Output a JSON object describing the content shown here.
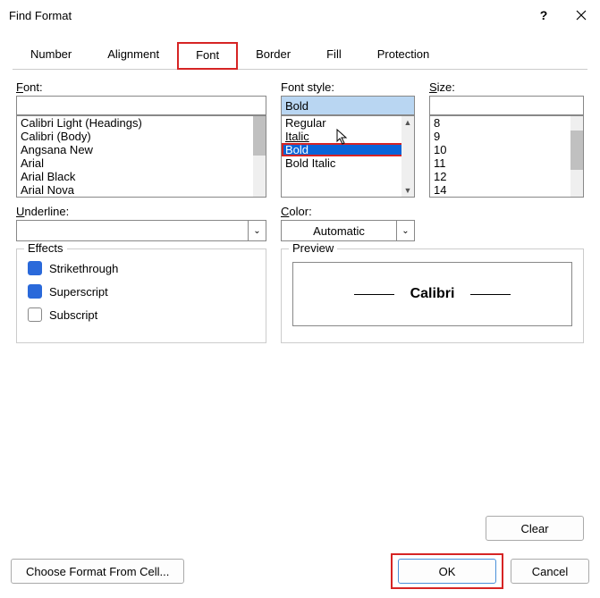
{
  "title": "Find Format",
  "tabs": {
    "number": "Number",
    "alignment": "Alignment",
    "font": "Font",
    "border": "Border",
    "fill": "Fill",
    "protection": "Protection"
  },
  "labels": {
    "font": "Font:",
    "fontstyle": "Font style:",
    "size": "Size:",
    "underline": "Underline:",
    "color": "Color:",
    "effects": "Effects",
    "preview": "Preview",
    "strike": "Strikethrough",
    "super": "Superscript",
    "sub": "Subscript"
  },
  "inputs": {
    "font_value": "",
    "style_value": "Bold",
    "size_value": "",
    "underline_value": "",
    "color_value": "Automatic"
  },
  "font_list": [
    "Calibri Light (Headings)",
    "Calibri (Body)",
    "Angsana New",
    "Arial",
    "Arial Black",
    "Arial Nova"
  ],
  "style_list": [
    "Regular",
    "Italic",
    "Bold",
    "Bold Italic"
  ],
  "size_list": [
    "8",
    "9",
    "10",
    "11",
    "12",
    "14"
  ],
  "preview_text": "Calibri",
  "buttons": {
    "clear": "Clear",
    "choose": "Choose Format From Cell...",
    "ok": "OK",
    "cancel": "Cancel"
  }
}
